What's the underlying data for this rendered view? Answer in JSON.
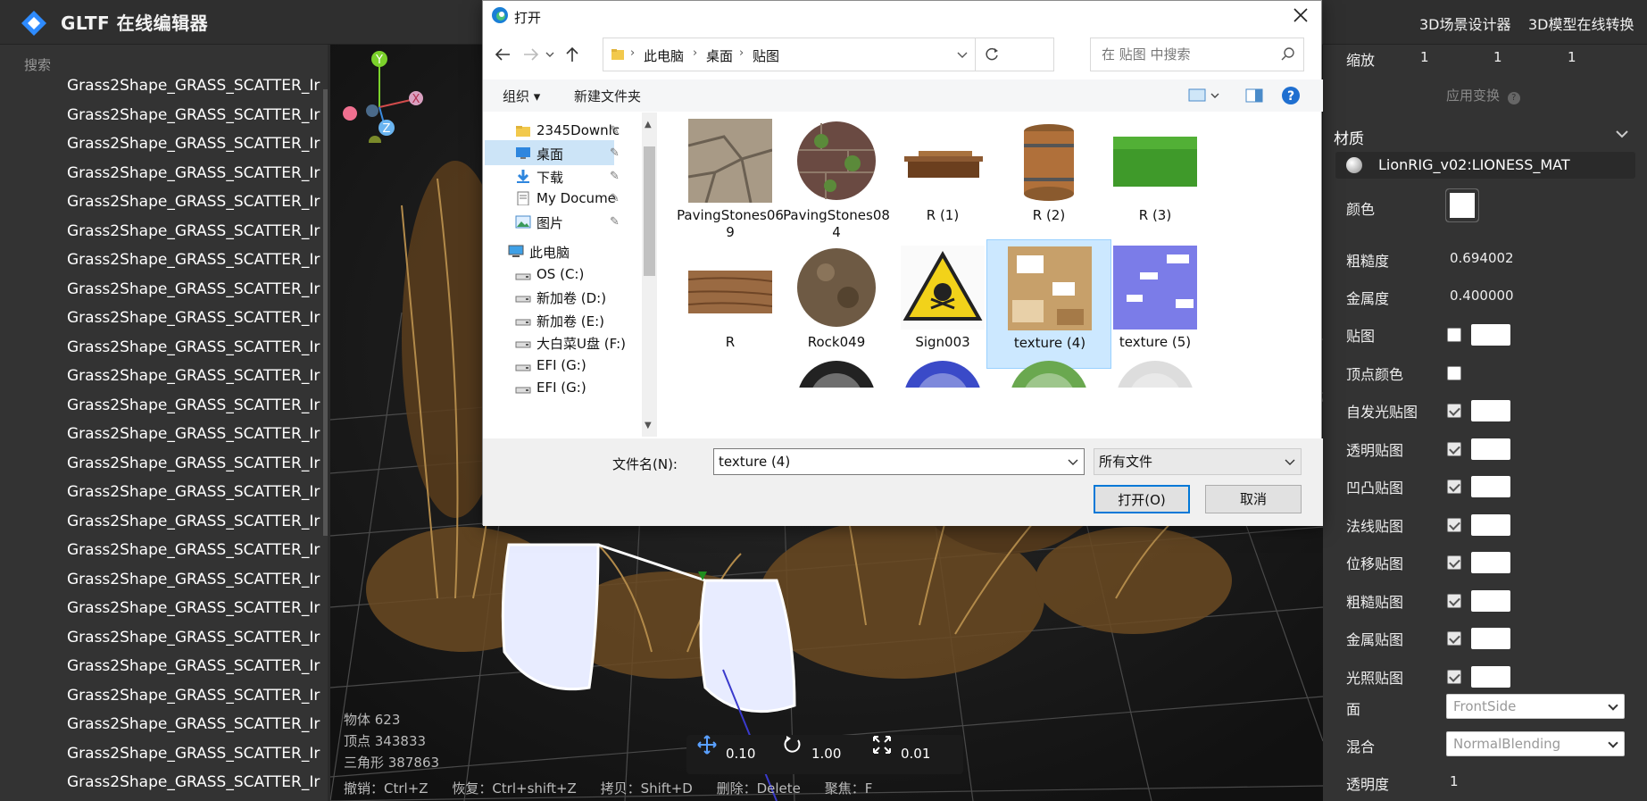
{
  "app": {
    "title": "GLTF 在线编辑器",
    "nav_links": [
      "3D场景设计器",
      "3D模型在线转换"
    ]
  },
  "left_panel": {
    "search_label": "搜索",
    "items": [
      "Grass2Shape_GRASS_SCATTER_Ir",
      "Grass2Shape_GRASS_SCATTER_Ir",
      "Grass2Shape_GRASS_SCATTER_Ir",
      "Grass2Shape_GRASS_SCATTER_Ir",
      "Grass2Shape_GRASS_SCATTER_Ir",
      "Grass2Shape_GRASS_SCATTER_Ir",
      "Grass2Shape_GRASS_SCATTER_Ir",
      "Grass2Shape_GRASS_SCATTER_Ir",
      "Grass2Shape_GRASS_SCATTER_Ir",
      "Grass2Shape_GRASS_SCATTER_Ir",
      "Grass2Shape_GRASS_SCATTER_Ir",
      "Grass2Shape_GRASS_SCATTER_Ir",
      "Grass2Shape_GRASS_SCATTER_Ir",
      "Grass2Shape_GRASS_SCATTER_Ir",
      "Grass2Shape_GRASS_SCATTER_Ir",
      "Grass2Shape_GRASS_SCATTER_Ir",
      "Grass2Shape_GRASS_SCATTER_Ir",
      "Grass2Shape_GRASS_SCATTER_Ir",
      "Grass2Shape_GRASS_SCATTER_Ir",
      "Grass2Shape_GRASS_SCATTER_Ir",
      "Grass2Shape_GRASS_SCATTER_Ir",
      "Grass2Shape_GRASS_SCATTER_Ir",
      "Grass2Shape_GRASS_SCATTER_Ir",
      "Grass2Shape_GRASS_SCATTER_Ir",
      "Grass2Shape_GRASS_SCATTER_Ir"
    ]
  },
  "viewport": {
    "stats": {
      "objects": "物体 623",
      "vertices": "顶点 343833",
      "triangles": "三角形 387863"
    },
    "transform": {
      "translate": "0.10",
      "rotate": "1.00",
      "scale": "0.01"
    },
    "shortcuts": [
      "撤销：Ctrl+Z",
      "恢复：Ctrl+shift+Z",
      "拷贝：Shift+D",
      "删除：Delete",
      "聚焦：F"
    ],
    "axes": {
      "y": "Y",
      "x": "X",
      "z": "Z"
    }
  },
  "right_panel": {
    "scale_label": "缩放",
    "scale_values": [
      "1",
      "1",
      "1"
    ],
    "apply_transform": "应用变换",
    "material_section": "材质",
    "material_name": "LionRIG_v02:LIONESS_MAT",
    "color_label": "颜色",
    "roughness_label": "粗糙度",
    "roughness_value": "0.694002",
    "metalness_label": "金属度",
    "metalness_value": "0.400000",
    "maps": [
      {
        "label": "贴图",
        "checked": false,
        "has_box": true
      },
      {
        "label": "顶点颜色",
        "checked": false,
        "has_box": false
      },
      {
        "label": "自发光贴图",
        "checked": true,
        "has_box": true
      },
      {
        "label": "透明贴图",
        "checked": true,
        "has_box": true
      },
      {
        "label": "凹凸贴图",
        "checked": true,
        "has_box": true
      },
      {
        "label": "法线贴图",
        "checked": true,
        "has_box": true
      },
      {
        "label": "位移贴图",
        "checked": true,
        "has_box": true
      },
      {
        "label": "粗糙贴图",
        "checked": true,
        "has_box": true
      },
      {
        "label": "金属贴图",
        "checked": true,
        "has_box": true
      },
      {
        "label": "光照贴图",
        "checked": true,
        "has_box": true
      }
    ],
    "side_label": "面",
    "side_value": "FrontSide",
    "blending_label": "混合",
    "blending_value": "NormalBlending",
    "opacity_label": "透明度",
    "opacity_value": "1"
  },
  "dialog": {
    "title": "打开",
    "breadcrumbs": [
      "此电脑",
      "桌面",
      "贴图"
    ],
    "search_placeholder": "在 贴图 中搜索",
    "organize": "组织",
    "new_folder": "新建文件夹",
    "nav_items": [
      {
        "label": "2345Downlc",
        "icon": "folder-icon",
        "pinned": true
      },
      {
        "label": "桌面",
        "icon": "desktop-icon",
        "pinned": true,
        "selected": true
      },
      {
        "label": "下载",
        "icon": "download-icon",
        "pinned": true
      },
      {
        "label": "My Docume",
        "icon": "document-icon",
        "pinned": true
      },
      {
        "label": "图片",
        "icon": "pictures-icon",
        "pinned": true
      },
      {
        "label": "此电脑",
        "icon": "computer-icon",
        "pinned": false
      },
      {
        "label": "OS (C:)",
        "icon": "drive-icon",
        "pinned": false
      },
      {
        "label": "新加卷 (D:)",
        "icon": "drive-icon",
        "pinned": false
      },
      {
        "label": "新加卷 (E:)",
        "icon": "drive-icon",
        "pinned": false
      },
      {
        "label": "大白菜U盘 (F:)",
        "icon": "drive-icon",
        "pinned": false
      },
      {
        "label": "EFI (G:)",
        "icon": "drive-icon",
        "pinned": false
      },
      {
        "label": "EFI (G:)",
        "icon": "drive-icon",
        "pinned": false
      }
    ],
    "files": [
      {
        "name": "PavingStones069",
        "lines": [
          "PavingStones06",
          "9"
        ]
      },
      {
        "name": "PavingStones084",
        "lines": [
          "PavingStones08",
          "4"
        ]
      },
      {
        "name": "R (1)",
        "lines": [
          "R (1)"
        ]
      },
      {
        "name": "R (2)",
        "lines": [
          "R (2)"
        ]
      },
      {
        "name": "R (3)",
        "lines": [
          "R (3)"
        ]
      },
      {
        "name": "R",
        "lines": [
          "R"
        ]
      },
      {
        "name": "Rock049",
        "lines": [
          "Rock049"
        ]
      },
      {
        "name": "Sign003",
        "lines": [
          "Sign003"
        ]
      },
      {
        "name": "texture (4)",
        "lines": [
          "texture (4)"
        ],
        "selected": true
      },
      {
        "name": "texture (5)",
        "lines": [
          "texture (5)"
        ]
      }
    ],
    "filename_label": "文件名(N):",
    "filename_value": "texture (4)",
    "filetype_value": "所有文件",
    "open_button": "打开(O)",
    "cancel_button": "取消"
  }
}
